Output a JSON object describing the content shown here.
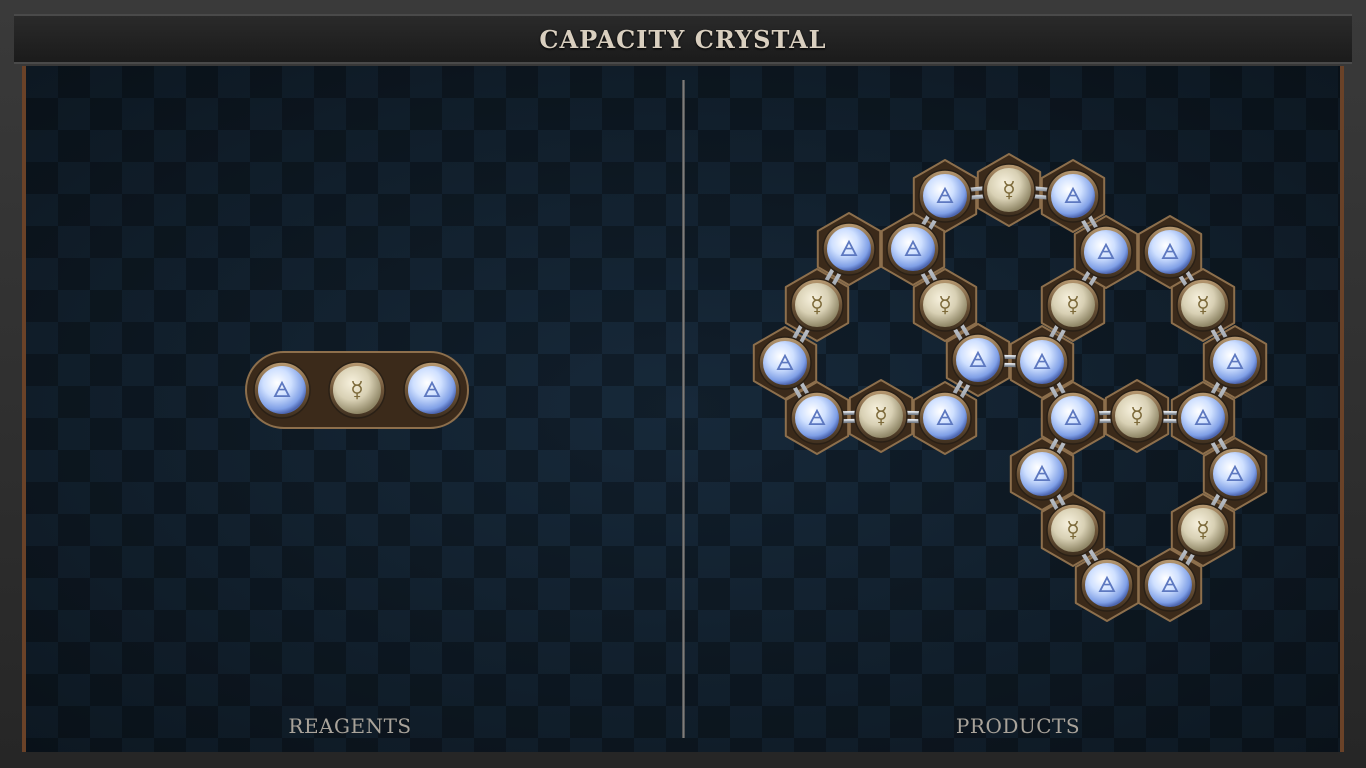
{
  "title": "CAPACITY CRYSTAL",
  "panels": {
    "reagents_label": "REAGENTS",
    "products_label": "PRODUCTS"
  },
  "symbols": {
    "air": "🜁",
    "quicksilver": "☿"
  },
  "colors": {
    "board": "#0f1d29",
    "rim": "#6a4228",
    "title_text": "#d9cfbf",
    "label_text": "#a9a39a",
    "air_orb": "#a9c8ff",
    "quicksilver_orb": "#d8d0b4"
  },
  "reagent": {
    "atoms": [
      "air",
      "quicksilver",
      "air"
    ]
  },
  "product": {
    "atom_count": 27,
    "air_atoms": 18,
    "quicksilver_atoms": 9
  }
}
